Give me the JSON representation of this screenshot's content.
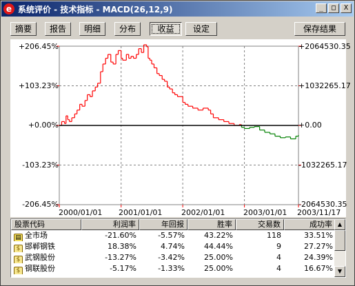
{
  "window": {
    "title": "系统评价 - 技术指标 - MACD(26,12,9)",
    "icon_char": "e"
  },
  "titlebar_buttons": {
    "min": "_",
    "max": "□",
    "close": "X"
  },
  "toolbar": {
    "tabs": [
      {
        "label": "摘要"
      },
      {
        "label": "报告"
      },
      {
        "label": "明细"
      },
      {
        "label": "分布"
      },
      {
        "label": "收益",
        "active": true
      },
      {
        "label": "设定"
      }
    ],
    "save_label": "保存结果"
  },
  "chart_data": {
    "type": "line",
    "left_ticks": [
      "+206.45%",
      "+103.23%",
      "+0.00%",
      "-103.23%",
      "-206.45%"
    ],
    "right_ticks": [
      "+2064530.35",
      "+1032265.17",
      "+0.00",
      "-1032265.17",
      "-2064530.35"
    ],
    "x_ticks": [
      "2000/01/01",
      "2001/01/01",
      "2002/01/01",
      "2003/01/01",
      "2003/11/17"
    ],
    "ylim": [
      -206.45,
      206.45
    ],
    "grid": true,
    "colors": {
      "positive": "#ff0000",
      "negative": "#008000",
      "zero_line": "#000000"
    },
    "series": [
      {
        "x": [
          "2000-01-01",
          "2000-01-15",
          "2000-02-01",
          "2000-02-10",
          "2000-02-20",
          "2000-03-01",
          "2000-03-15",
          "2000-04-01",
          "2000-04-15",
          "2000-05-01",
          "2000-05-15",
          "2000-06-01",
          "2000-06-15",
          "2000-07-01",
          "2000-07-15",
          "2000-08-01",
          "2000-08-15",
          "2000-09-01",
          "2000-09-15",
          "2000-10-01",
          "2000-10-15",
          "2000-11-01",
          "2000-11-15",
          "2000-12-01",
          "2000-12-15",
          "2001-01-01",
          "2001-01-10",
          "2001-02-01",
          "2001-02-15",
          "2001-03-01",
          "2001-03-15",
          "2001-04-01",
          "2001-04-15",
          "2001-05-01",
          "2001-05-15",
          "2001-06-01",
          "2001-06-10",
          "2001-06-20",
          "2001-07-01",
          "2001-07-15",
          "2001-08-01",
          "2001-08-15",
          "2001-09-01",
          "2001-09-15",
          "2001-10-01",
          "2001-10-15",
          "2001-11-01",
          "2001-11-15",
          "2001-12-01",
          "2001-12-15",
          "2002-01-01",
          "2002-01-15",
          "2002-02-01",
          "2002-03-01",
          "2002-04-01",
          "2002-05-01",
          "2002-06-01",
          "2002-06-15",
          "2002-07-01",
          "2002-08-01",
          "2002-09-01",
          "2002-10-01",
          "2002-11-01",
          "2002-11-15",
          "2002-12-01",
          "2002-12-15",
          "2003-01-01",
          "2003-02-01",
          "2003-03-01",
          "2003-04-01",
          "2003-05-01",
          "2003-06-01",
          "2003-07-01",
          "2003-08-01",
          "2003-09-01",
          "2003-10-01",
          "2003-11-01",
          "2003-11-17"
        ],
        "y": [
          0,
          10,
          5,
          25,
          15,
          10,
          20,
          30,
          40,
          55,
          50,
          65,
          80,
          75,
          90,
          100,
          110,
          140,
          160,
          175,
          185,
          165,
          160,
          185,
          195,
          175,
          170,
          185,
          175,
          180,
          175,
          185,
          200,
          190,
          210,
          205,
          175,
          170,
          160,
          150,
          135,
          130,
          120,
          115,
          100,
          95,
          85,
          80,
          75,
          75,
          60,
          55,
          50,
          45,
          40,
          45,
          40,
          30,
          20,
          15,
          10,
          5,
          0,
          0,
          2,
          -5,
          -8,
          -5,
          -3,
          -12,
          -18,
          -22,
          -28,
          -32,
          -30,
          -35,
          -28,
          -25
        ]
      }
    ]
  },
  "table": {
    "headers": [
      "股票代码",
      "利润率",
      "年回报",
      "胜率",
      "交易数",
      "成功率"
    ],
    "rows": [
      {
        "icon": "folder-icon",
        "cells": [
          "全市场",
          "-21.60%",
          "-5.57%",
          "43.22%",
          "118",
          "33.51%"
        ]
      },
      {
        "icon": "stock-icon",
        "cells": [
          "邯郸钢铁",
          "18.38%",
          "4.74%",
          "44.44%",
          "9",
          "27.27%"
        ]
      },
      {
        "icon": "stock-icon",
        "cells": [
          "武钢股份",
          "-13.27%",
          "-3.42%",
          "25.00%",
          "4",
          "24.39%"
        ]
      },
      {
        "icon": "stock-icon",
        "cells": [
          "钢联股份",
          "-5.17%",
          "-1.33%",
          "25.00%",
          "4",
          "16.67%"
        ]
      }
    ],
    "stock_icon_char": "$",
    "folder_icon_char": "▤"
  }
}
